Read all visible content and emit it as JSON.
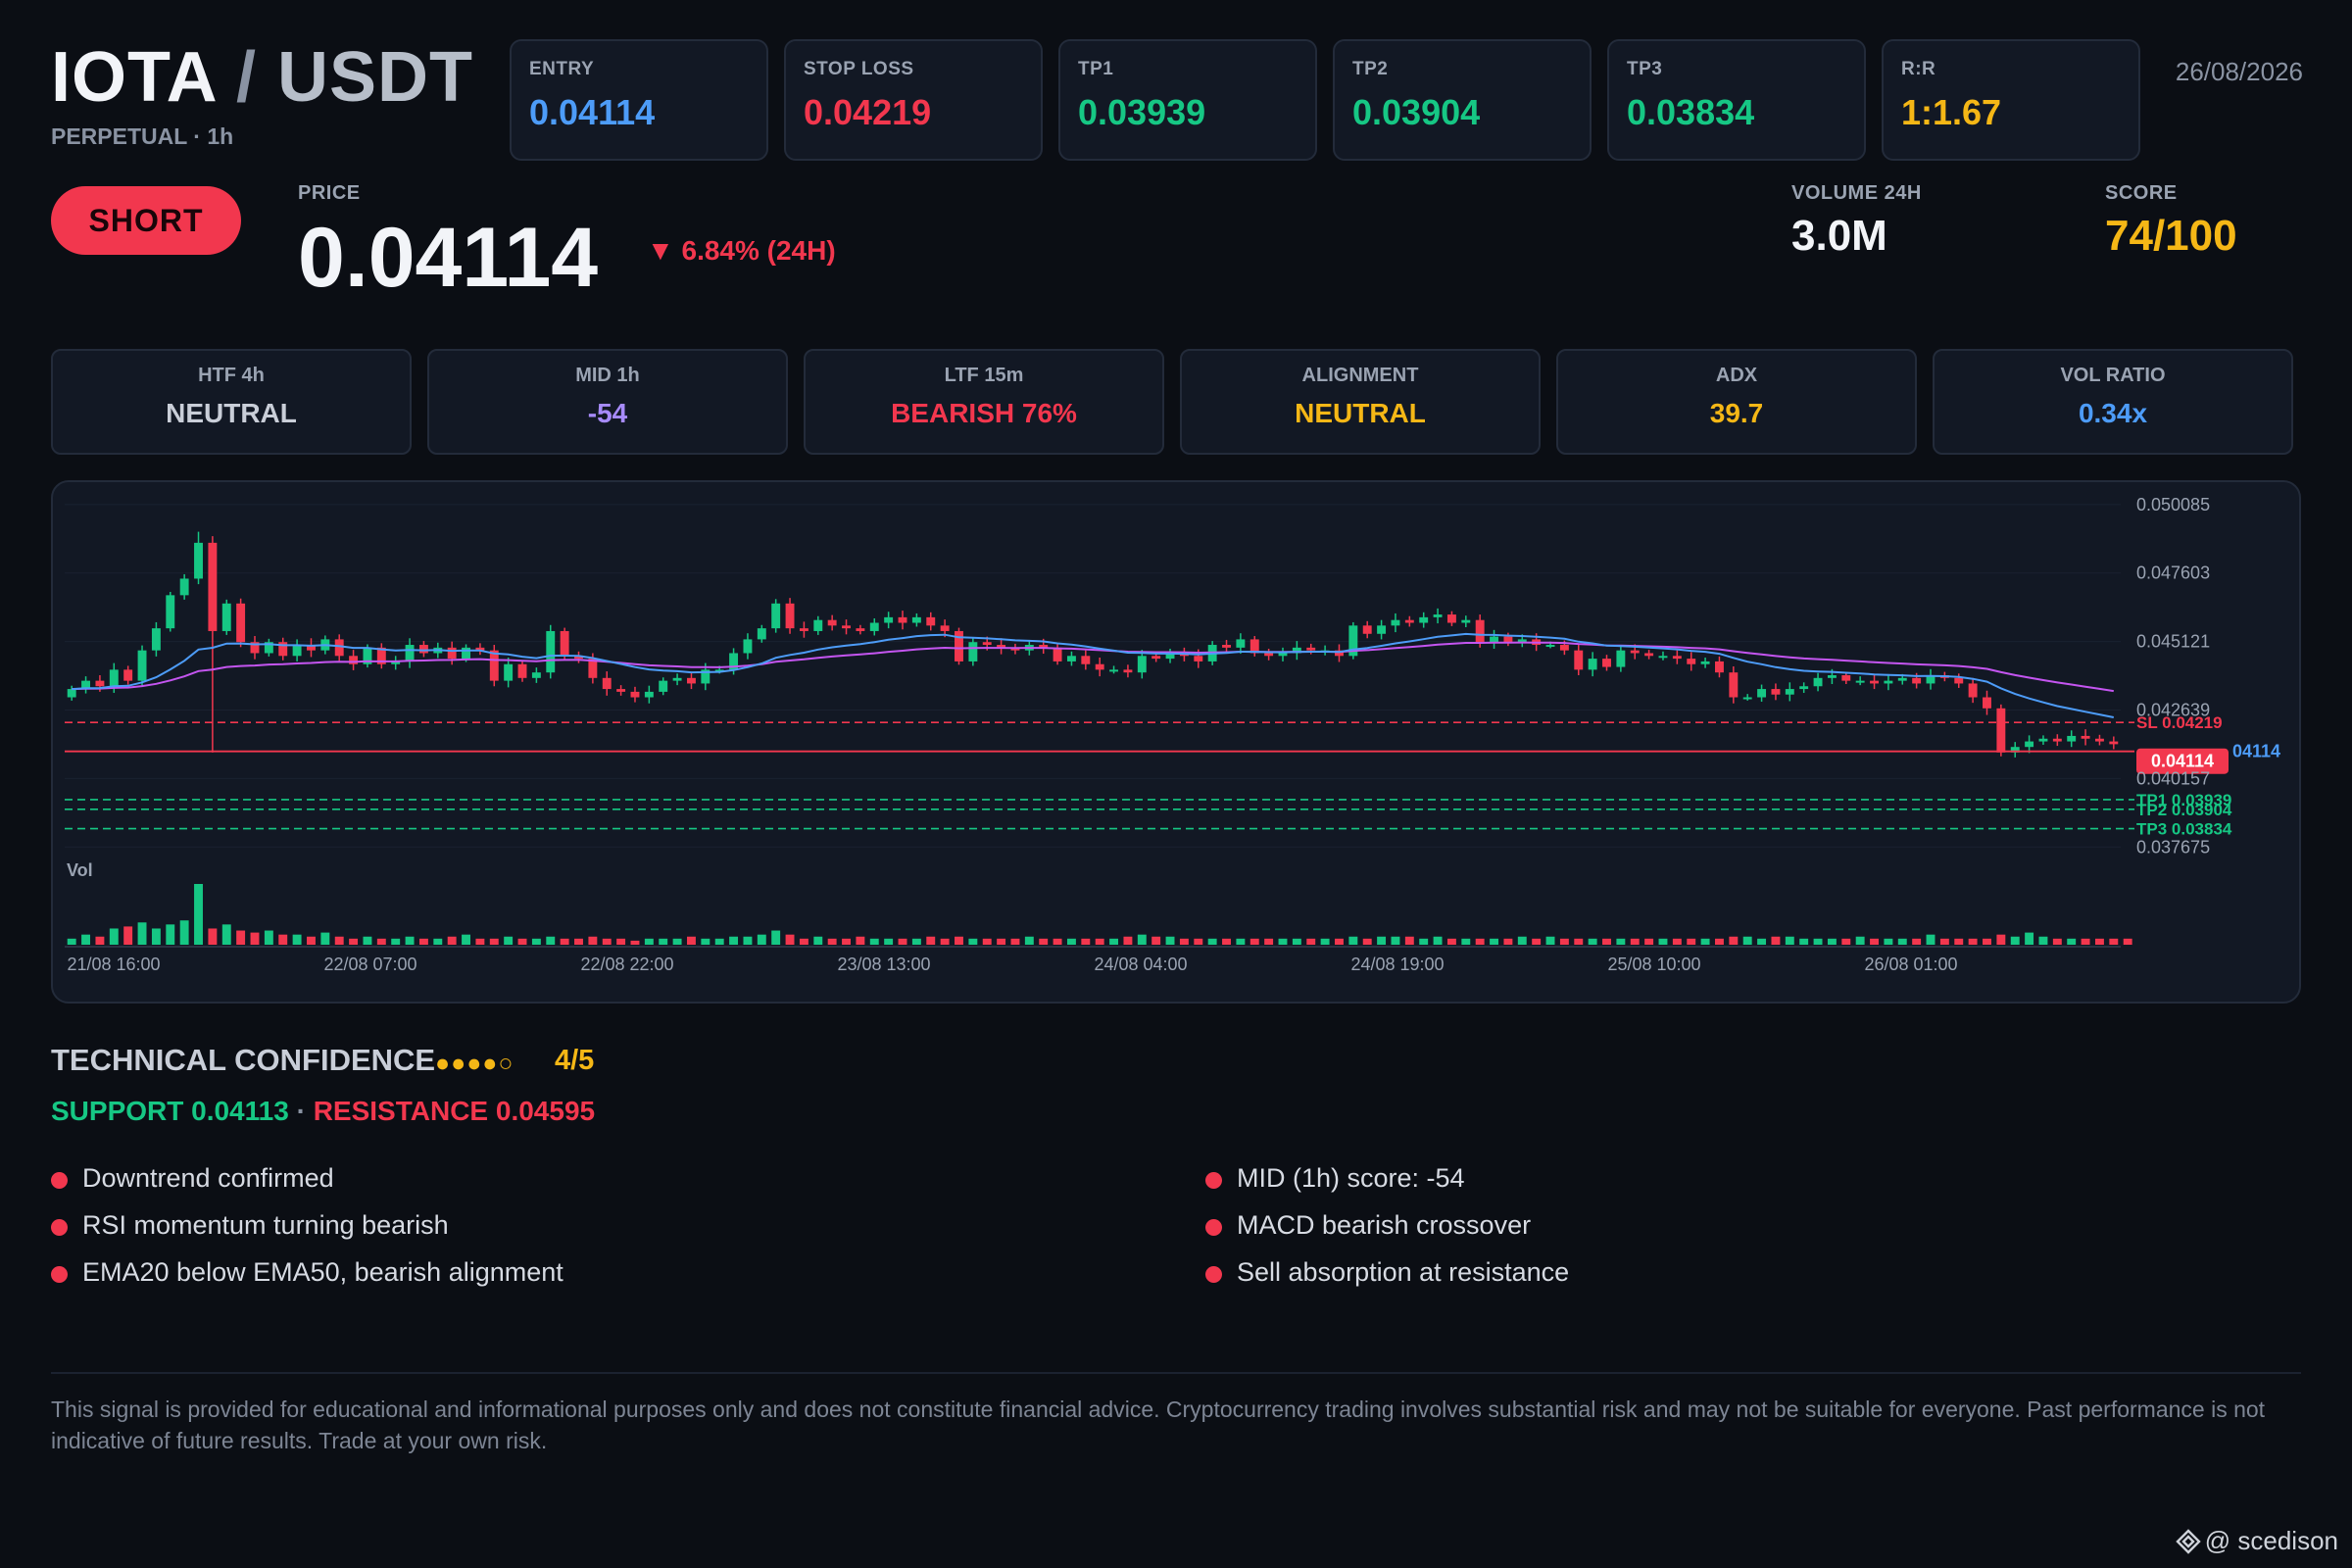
{
  "header": {
    "pair_base": "IOTA",
    "pair_slash": "/",
    "pair_quote": "USDT",
    "subtitle": "PERPETUAL · 1h",
    "date": "26/08/2026"
  },
  "levels": [
    {
      "label": "ENTRY",
      "value": "0.04114",
      "color": "#4d9cf8"
    },
    {
      "label": "STOP LOSS",
      "value": "0.04219",
      "color": "#f2374e"
    },
    {
      "label": "TP1",
      "value": "0.03939",
      "color": "#16c784"
    },
    {
      "label": "TP2",
      "value": "0.03904",
      "color": "#16c784"
    },
    {
      "label": "TP3",
      "value": "0.03834",
      "color": "#16c784"
    },
    {
      "label": "R:R",
      "value": "1:1.67",
      "color": "#f5b716"
    }
  ],
  "signal": {
    "side": "SHORT",
    "price_label": "PRICE",
    "price": "0.04114",
    "change": "▼ 6.84% (24H)",
    "volume_label": "VOLUME 24H",
    "volume": "3.0M",
    "score_label": "SCORE",
    "score": "74/100"
  },
  "timeframes": [
    {
      "label": "HTF 4h",
      "value": "NEUTRAL",
      "color": "#c9ced8"
    },
    {
      "label": "MID 1h",
      "value": "-54",
      "color": "#a78bfa"
    },
    {
      "label": "LTF 15m",
      "value": "BEARISH 76%",
      "color": "#f2374e"
    },
    {
      "label": "ALIGNMENT",
      "value": "NEUTRAL",
      "color": "#f5b716"
    },
    {
      "label": "ADX",
      "value": "39.7",
      "color": "#f5b716"
    },
    {
      "label": "VOL RATIO",
      "value": "0.34x",
      "color": "#4d9cf8"
    }
  ],
  "chart_data": {
    "type": "candlestick",
    "interval": "1h",
    "y_ticks": [
      "0.050085",
      "0.047603",
      "0.045121",
      "0.042639",
      "0.040157",
      "0.037675"
    ],
    "ylim": [
      0.0374,
      0.0504
    ],
    "x_ticks": [
      "21/08 16:00",
      "22/08 07:00",
      "22/08 22:00",
      "23/08 13:00",
      "24/08 04:00",
      "24/08 19:00",
      "25/08 10:00",
      "26/08 01:00"
    ],
    "volume_label": "Vol",
    "price_lines": [
      {
        "label": "SL 0.04219",
        "value": 0.04219,
        "color": "#f2374e",
        "style": "dashed"
      },
      {
        "label": "0.04114",
        "value": 0.04114,
        "color": "#f2374e",
        "style": "solid"
      },
      {
        "label": "TP1 0.03939",
        "value": 0.03939,
        "color": "#16c784",
        "style": "dashed"
      },
      {
        "label": "TP2 0.03904",
        "value": 0.03904,
        "color": "#16c784",
        "style": "dashed"
      },
      {
        "label": "TP3 0.03834",
        "value": 0.03834,
        "color": "#16c784",
        "style": "dashed"
      }
    ],
    "entry_tag": "0.04114",
    "entry_tag_side": "04114",
    "entry_tag_color": "#4d9cf8",
    "ema20_color": "#4d9cf8",
    "ema50_color": "#c455f0",
    "up_color": "#16c784",
    "down_color": "#f2374e",
    "closes": [
      0.0434,
      0.0437,
      0.0435,
      0.0441,
      0.0437,
      0.0448,
      0.0456,
      0.0468,
      0.0474,
      0.0487,
      0.0455,
      0.0465,
      0.0451,
      0.0447,
      0.0451,
      0.0446,
      0.045,
      0.0448,
      0.0452,
      0.0446,
      0.0443,
      0.0449,
      0.0443,
      0.0444,
      0.045,
      0.0447,
      0.0449,
      0.0445,
      0.0449,
      0.0448,
      0.0437,
      0.0443,
      0.0438,
      0.044,
      0.0455,
      0.0446,
      0.0445,
      0.0438,
      0.0434,
      0.0433,
      0.0431,
      0.0433,
      0.0437,
      0.0438,
      0.0436,
      0.0441,
      0.0441,
      0.0447,
      0.0452,
      0.0456,
      0.0465,
      0.0456,
      0.0455,
      0.0459,
      0.0457,
      0.0456,
      0.0455,
      0.0458,
      0.046,
      0.0458,
      0.046,
      0.0457,
      0.0455,
      0.0444,
      0.0451,
      0.045,
      0.0449,
      0.0448,
      0.045,
      0.0449,
      0.0444,
      0.0446,
      0.0443,
      0.0441,
      0.0441,
      0.044,
      0.0446,
      0.0445,
      0.0447,
      0.0446,
      0.0444,
      0.045,
      0.0449,
      0.0452,
      0.0447,
      0.0446,
      0.0447,
      0.0449,
      0.0448,
      0.0448,
      0.0446,
      0.0457,
      0.0454,
      0.0457,
      0.0459,
      0.0458,
      0.046,
      0.0461,
      0.0458,
      0.0459,
      0.0451,
      0.0453,
      0.0451,
      0.0452,
      0.045,
      0.045,
      0.0448,
      0.0441,
      0.0445,
      0.0442,
      0.0448,
      0.0447,
      0.0446,
      0.0446,
      0.0445,
      0.0443,
      0.0444,
      0.044,
      0.0431,
      0.0431,
      0.0434,
      0.0432,
      0.0434,
      0.0435,
      0.0438,
      0.0439,
      0.0437,
      0.0437,
      0.0436,
      0.0437,
      0.0438,
      0.0436,
      0.0439,
      0.0438,
      0.0436,
      0.0431,
      0.0427,
      0.0411,
      0.0413,
      0.0415,
      0.0416,
      0.0415,
      0.0417,
      0.0416,
      0.0415,
      0.0414
    ],
    "volumes": [
      3,
      5,
      4,
      8,
      9,
      11,
      8,
      10,
      12,
      30,
      8,
      10,
      7,
      6,
      7,
      5,
      5,
      4,
      6,
      4,
      3,
      4,
      3,
      3,
      4,
      3,
      3,
      4,
      5,
      3,
      3,
      4,
      3,
      3,
      4,
      3,
      3,
      4,
      3,
      3,
      2,
      3,
      3,
      3,
      4,
      3,
      3,
      4,
      4,
      5,
      7,
      5,
      3,
      4,
      3,
      3,
      4,
      3,
      3,
      3,
      3,
      4,
      3,
      4,
      3,
      3,
      3,
      3,
      4,
      3,
      3,
      3,
      3,
      3,
      3,
      4,
      5,
      4,
      4,
      3,
      3,
      3,
      3,
      3,
      3,
      3,
      3,
      3,
      3,
      3,
      3,
      4,
      3,
      4,
      4,
      4,
      3,
      4,
      3,
      3,
      3,
      3,
      3,
      4,
      3,
      4,
      3,
      3,
      3,
      3,
      3,
      3,
      3,
      3,
      3,
      3,
      3,
      3,
      4,
      4,
      3,
      4,
      4,
      3,
      3,
      3,
      3,
      4,
      3,
      3,
      3,
      3,
      5,
      3,
      3,
      3,
      3,
      5,
      4,
      6,
      4,
      3,
      3,
      3,
      3,
      3,
      3
    ]
  },
  "technical": {
    "title": "TECHNICAL CONFIDENCE",
    "dots_on": "●●●●",
    "dots_off": "○",
    "score": "4/5",
    "support": "SUPPORT 0.04113",
    "separator": " · ",
    "resistance": "RESISTANCE 0.04595",
    "left_bullets": [
      "Downtrend confirmed",
      "RSI momentum turning bearish",
      "EMA20 below EMA50, bearish alignment"
    ],
    "right_bullets": [
      "MID (1h) score: -54",
      "MACD bearish crossover",
      "Sell absorption at resistance"
    ]
  },
  "footer": {
    "disclaimer": "This signal is provided for educational and informational purposes only and does not constitute financial advice. Cryptocurrency trading involves substantial risk and may not be suitable for everyone. Past performance is not indicative of future results. Trade at your own risk.",
    "watermark_icon": "binance-logo-icon",
    "watermark": "@ scedison"
  }
}
